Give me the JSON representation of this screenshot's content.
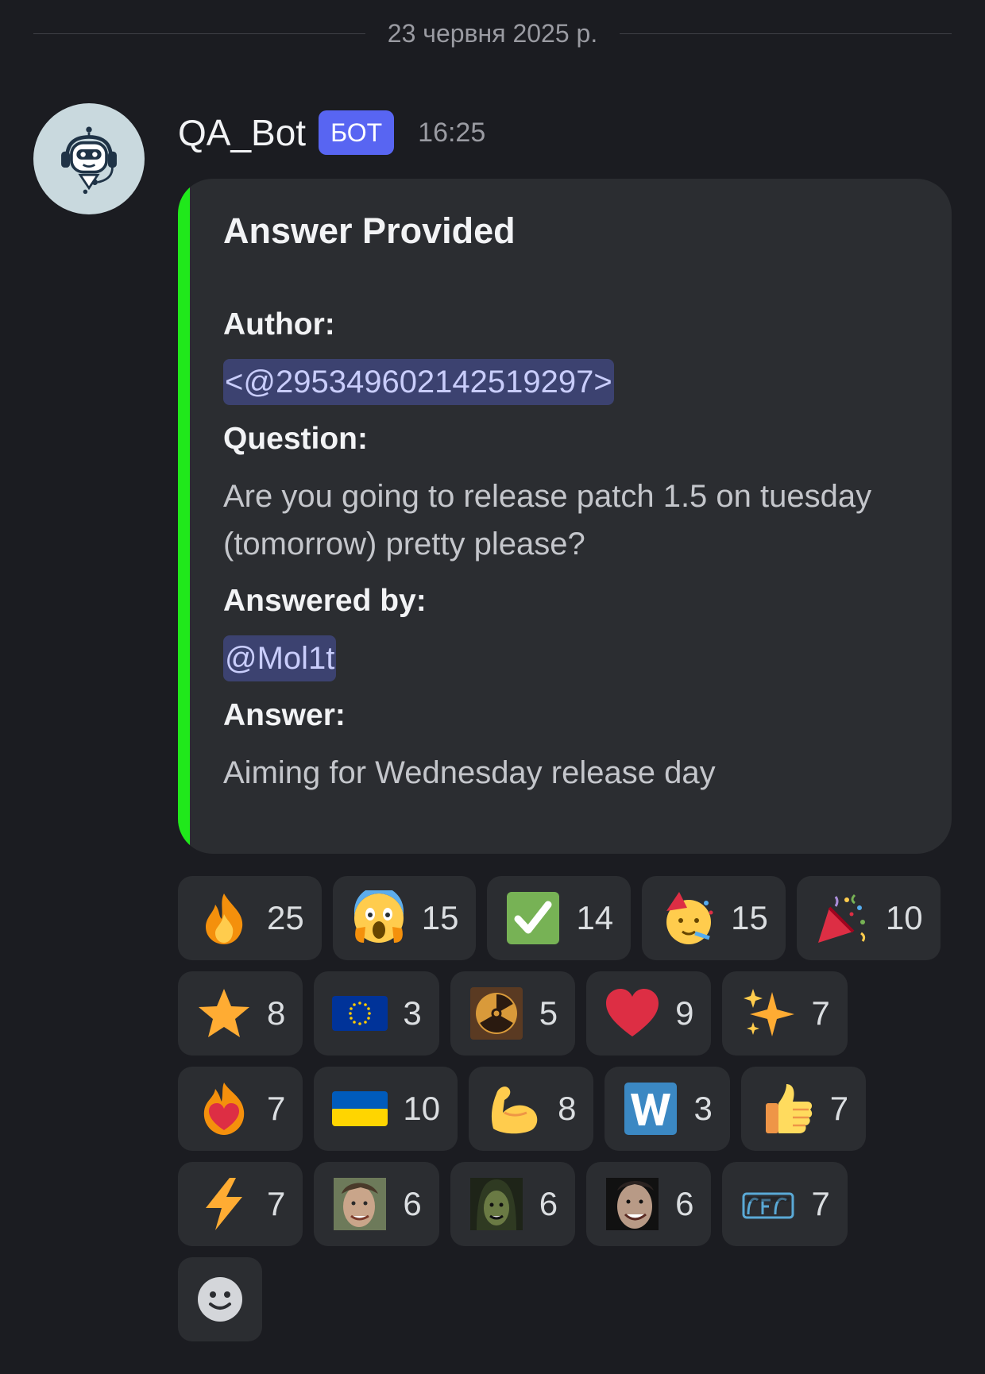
{
  "date_separator": "23 червня 2025 р.",
  "message": {
    "username": "QA_Bot",
    "badge": "БОТ",
    "timestamp": "16:25",
    "avatar_icon": "robot-headset-icon"
  },
  "embed": {
    "accent_color": "#20e81b",
    "title": "Answer Provided",
    "fields": [
      {
        "name": "Author:",
        "value": "<@295349602142519297>",
        "is_mention": true
      },
      {
        "name": "Question:",
        "value": "Are you going to release patch 1.5 on tuesday (tomorrow) pretty please?",
        "is_mention": false
      },
      {
        "name": "Answered by:",
        "value": "@Mol1t",
        "is_mention": true
      },
      {
        "name": "Answer:",
        "value": "Aiming for Wednesday release day",
        "is_mention": false
      }
    ]
  },
  "reactions": [
    [
      {
        "icon": "fire-icon",
        "count": "25"
      },
      {
        "icon": "face-screaming-icon",
        "count": "15"
      },
      {
        "icon": "check-mark-icon",
        "count": "14"
      },
      {
        "icon": "partying-face-icon",
        "count": "15"
      },
      {
        "icon": "party-popper-icon",
        "count": "10"
      }
    ],
    [
      {
        "icon": "star-icon",
        "count": "8"
      },
      {
        "icon": "eu-flag-icon",
        "count": "3"
      },
      {
        "icon": "radiation-icon",
        "count": "5"
      },
      {
        "icon": "heart-icon",
        "count": "9"
      },
      {
        "icon": "sparkles-icon",
        "count": "7"
      }
    ],
    [
      {
        "icon": "heart-on-fire-icon",
        "count": "7"
      },
      {
        "icon": "ukraine-flag-icon",
        "count": "10"
      },
      {
        "icon": "flexed-biceps-icon",
        "count": "8"
      },
      {
        "icon": "letter-w-icon",
        "count": "3"
      },
      {
        "icon": "thumbs-up-icon",
        "count": "7"
      }
    ],
    [
      {
        "icon": "lightning-icon",
        "count": "7"
      },
      {
        "icon": "custom-face-1-icon",
        "count": "6"
      },
      {
        "icon": "custom-face-2-icon",
        "count": "6"
      },
      {
        "icon": "custom-face-3-icon",
        "count": "6"
      },
      {
        "icon": "custom-logo-icon",
        "count": "7"
      }
    ]
  ],
  "add_reaction_icon": "add-reaction-smiley-icon"
}
